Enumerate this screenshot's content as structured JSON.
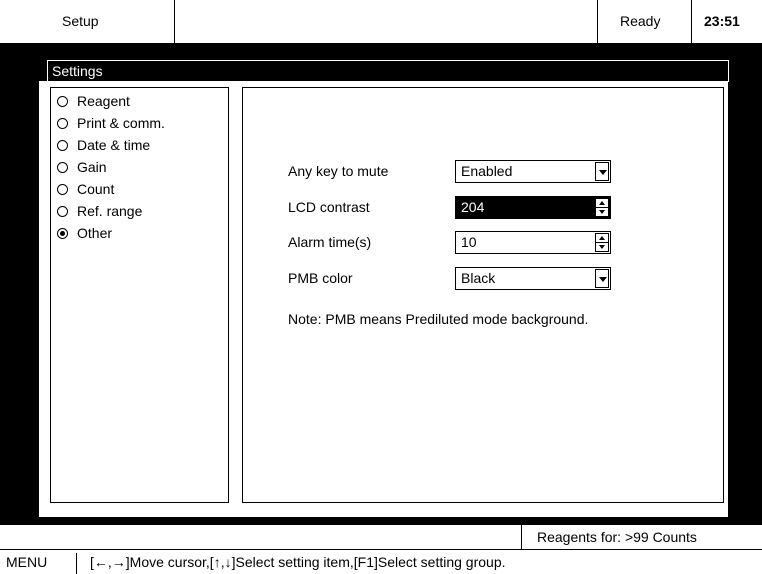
{
  "topbar": {
    "title": "Setup",
    "status": "Ready",
    "time": "23:51"
  },
  "settings": {
    "header": "Settings",
    "groups": [
      {
        "label": "Reagent",
        "selected": false
      },
      {
        "label": "Print & comm.",
        "selected": false
      },
      {
        "label": "Date & time",
        "selected": false
      },
      {
        "label": "Gain",
        "selected": false
      },
      {
        "label": "Count",
        "selected": false
      },
      {
        "label": "Ref. range",
        "selected": false
      },
      {
        "label": "Other",
        "selected": true
      }
    ],
    "fields": {
      "mute_label": "Any key to mute",
      "mute_value": "Enabled",
      "lcd_label": "LCD contrast",
      "lcd_value": "204",
      "alarm_label": "Alarm time(s)",
      "alarm_value": "10",
      "pmb_label": "PMB color",
      "pmb_value": "Black"
    },
    "note": "Note: PMB means Prediluted mode background."
  },
  "status": {
    "reagents": "Reagents for: >99 Counts"
  },
  "menu": {
    "label": "MENU",
    "help": "[←,→]Move cursor,[↑,↓]Select setting item,[F1]Select setting group."
  }
}
